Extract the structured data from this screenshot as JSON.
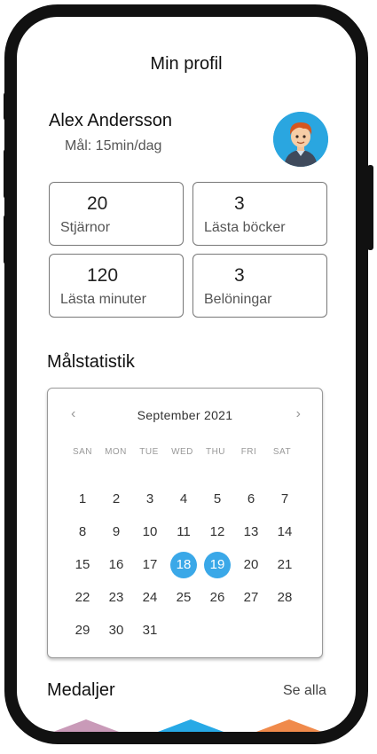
{
  "header": {
    "title": "Min profil"
  },
  "user": {
    "name": "Alex Andersson",
    "goal": "Mål: 15min/dag"
  },
  "stats": [
    {
      "value": "20",
      "label": "Stjärnor"
    },
    {
      "value": "3",
      "label": "Lästa böcker"
    },
    {
      "value": "120",
      "label": "Lästa minuter"
    },
    {
      "value": "3",
      "label": "Belöningar"
    }
  ],
  "goal_stats": {
    "title": "Målstatistik",
    "calendar": {
      "month": "September 2021",
      "prev_icon": "‹",
      "next_icon": "›",
      "weekdays": [
        "SAN",
        "MON",
        "TUE",
        "WED",
        "THU",
        "FRI",
        "SAT"
      ],
      "weeks": [
        [
          "1",
          "2",
          "3",
          "4",
          "5",
          "6",
          "7"
        ],
        [
          "8",
          "9",
          "10",
          "11",
          "12",
          "13",
          "14"
        ],
        [
          "15",
          "16",
          "17",
          "18",
          "19",
          "20",
          "21"
        ],
        [
          "22",
          "23",
          "24",
          "25",
          "26",
          "27",
          "28"
        ],
        [
          "29",
          "30",
          "31",
          "",
          "",
          "",
          ""
        ]
      ],
      "selected": [
        "18",
        "19"
      ]
    }
  },
  "medals": {
    "title": "Medaljer",
    "see_all": "Se alla",
    "colors": [
      "#c99ab8",
      "#27a9e6",
      "#f08a4b"
    ]
  }
}
